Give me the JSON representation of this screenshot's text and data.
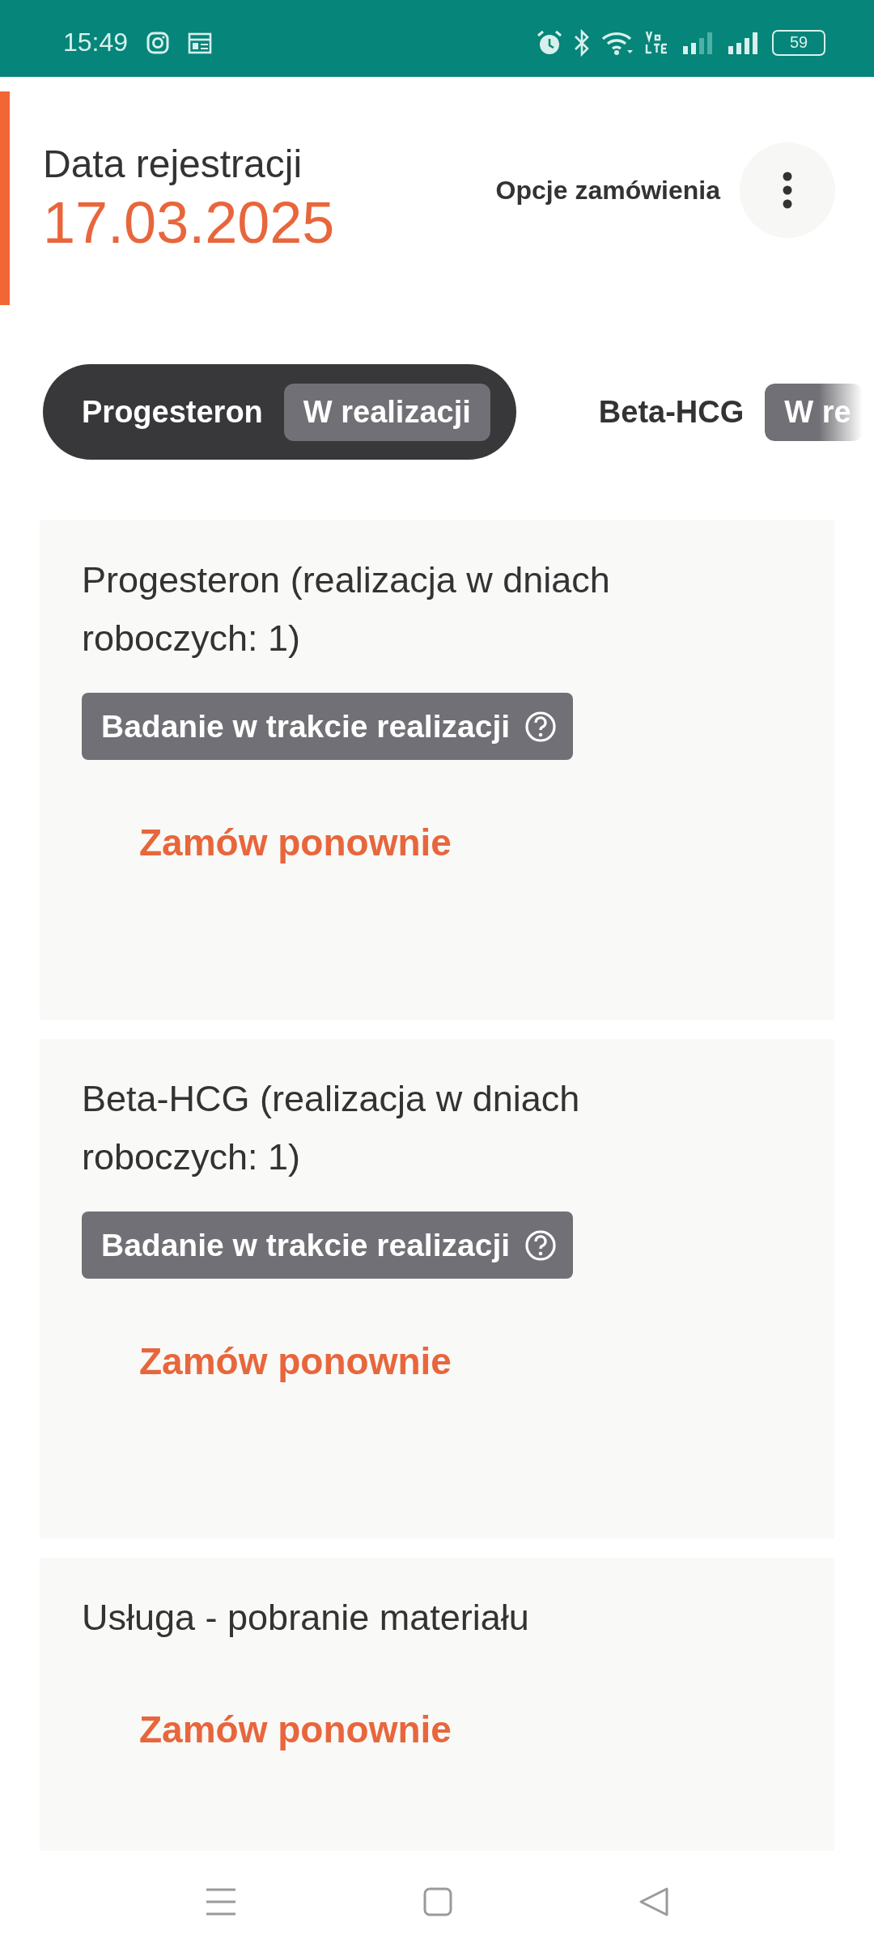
{
  "status_bar": {
    "time": "15:49",
    "battery": "59"
  },
  "header": {
    "label": "Data rejestracji",
    "date": "17.03.2025",
    "options_label": "Opcje zamówienia"
  },
  "tabs": [
    {
      "label": "Progesteron",
      "status": "W realizacji",
      "selected": true
    },
    {
      "label": "Beta-HCG",
      "status": "W re",
      "selected": false
    }
  ],
  "cards": [
    {
      "title": "Progesteron (realizacja w dniach roboczych: 1)",
      "badge": "Badanie w trakcie realizacji",
      "action": "Zamów ponownie"
    },
    {
      "title": "Beta-HCG (realizacja w dniach roboczych: 1)",
      "badge": "Badanie w trakcie realizacji",
      "action": "Zamów ponownie"
    },
    {
      "title": "Usługa - pobranie materiału",
      "action": "Zamów ponownie"
    }
  ]
}
